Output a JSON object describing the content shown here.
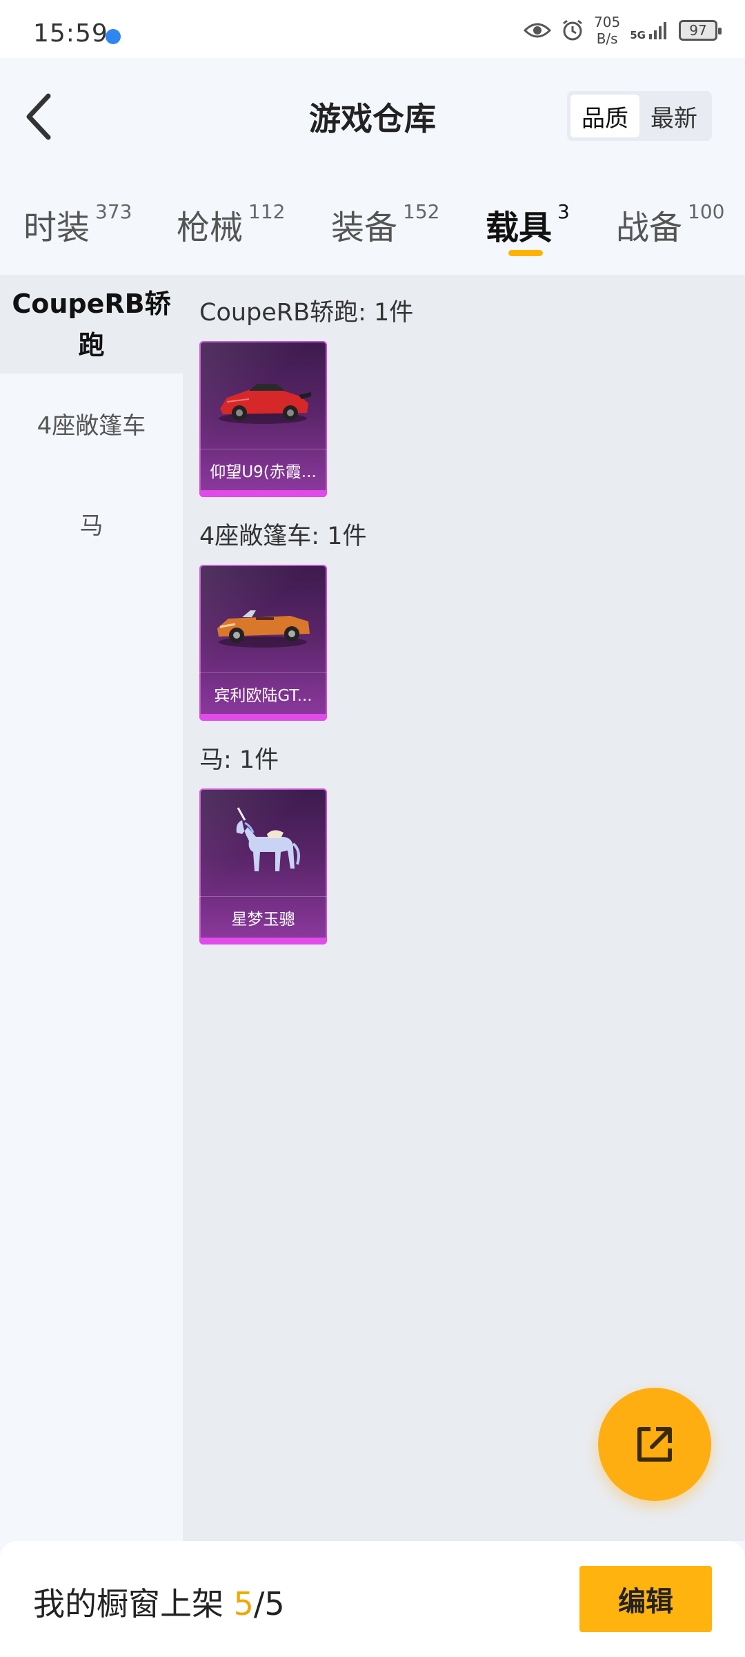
{
  "status_bar": {
    "time": "15:59",
    "net_speed_value": "705",
    "net_speed_unit": "B/s",
    "network": "5G",
    "battery": "97"
  },
  "header": {
    "title": "游戏仓库",
    "sort_options": [
      "品质",
      "最新"
    ],
    "sort_selected": "品质"
  },
  "tabs": [
    {
      "label": "时装",
      "count": "373"
    },
    {
      "label": "枪械",
      "count": "112"
    },
    {
      "label": "装备",
      "count": "152"
    },
    {
      "label": "载具",
      "count": "3"
    },
    {
      "label": "战备",
      "count": "100"
    }
  ],
  "active_tab": "载具",
  "sidebar": {
    "items": [
      {
        "label": "CoupeRB轿跑"
      },
      {
        "label": "4座敞篷车"
      },
      {
        "label": "马"
      }
    ]
  },
  "groups": [
    {
      "title": "CoupeRB轿跑: 1件",
      "item_name": "仰望U9(赤霞...",
      "art": "red-sports-car"
    },
    {
      "title": "4座敞篷车: 1件",
      "item_name": "宾利欧陆GT...",
      "art": "orange-convertible"
    },
    {
      "title": "马: 1件",
      "item_name": "星梦玉骢",
      "art": "crystal-unicorn"
    }
  ],
  "bottom_bar": {
    "showcase_label": "我的橱窗上架",
    "showcase_count": "5",
    "showcase_sep": "/",
    "showcase_total": "5",
    "edit_label": "编辑"
  },
  "colors": {
    "accent": "#ffb300",
    "card_purple": "#8e3aa0",
    "card_edge": "#e14be9"
  }
}
